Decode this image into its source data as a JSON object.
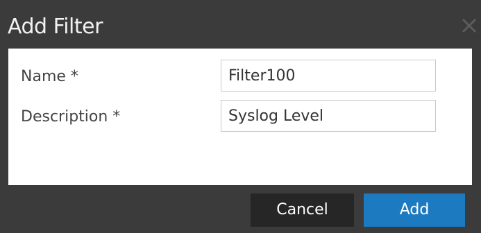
{
  "dialog": {
    "title": "Add Filter",
    "close_icon": "close-icon"
  },
  "form": {
    "name_label": "Name *",
    "name_value": "Filter100",
    "description_label": "Description *",
    "description_value": "Syslog Level"
  },
  "footer": {
    "cancel_label": "Cancel",
    "add_label": "Add"
  },
  "colors": {
    "dialog_bg": "#3b3b3b",
    "body_bg": "#ffffff",
    "cancel_bg": "#262626",
    "primary": "#1c7ac0"
  }
}
